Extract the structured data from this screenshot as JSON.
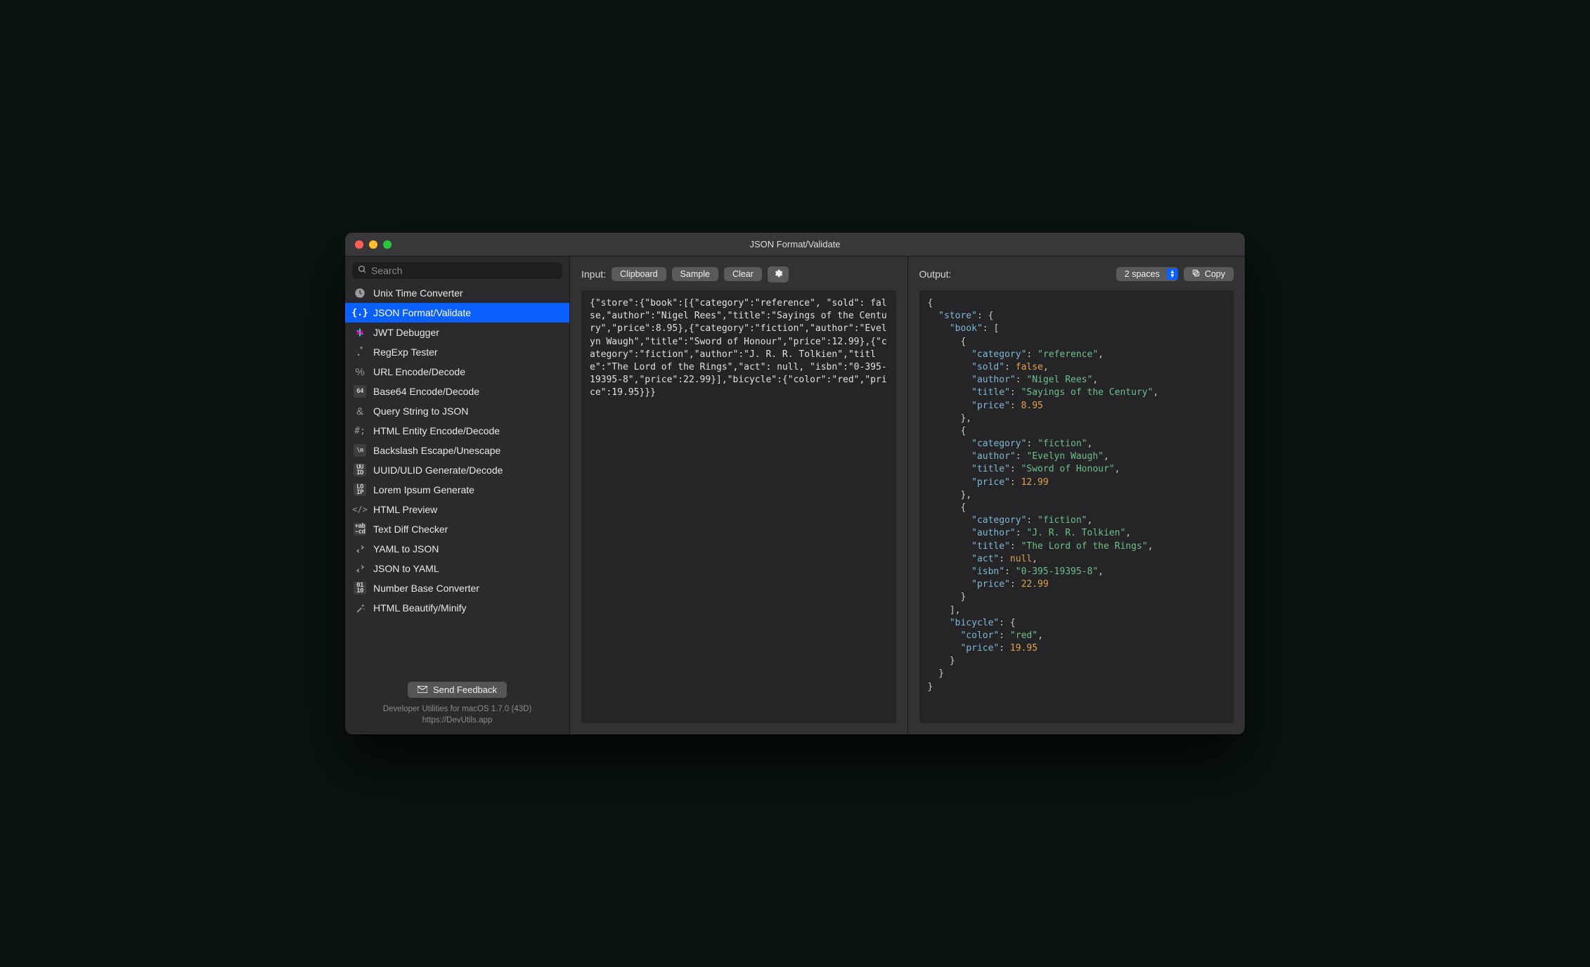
{
  "window": {
    "title": "JSON Format/Validate"
  },
  "search": {
    "placeholder": "Search"
  },
  "sidebar": {
    "items": [
      {
        "icon": "clock",
        "label": "Unix Time Converter"
      },
      {
        "icon": "braces",
        "label": "JSON Format/Validate",
        "selected": true
      },
      {
        "icon": "jwt",
        "label": "JWT Debugger"
      },
      {
        "icon": "regex",
        "label": "RegExp Tester"
      },
      {
        "icon": "percent",
        "label": "URL Encode/Decode"
      },
      {
        "icon": "b64",
        "label": "Base64 Encode/Decode",
        "badge": "64"
      },
      {
        "icon": "amp",
        "label": "Query String to JSON"
      },
      {
        "icon": "hash",
        "label": "HTML Entity Encode/Decode"
      },
      {
        "icon": "bslash",
        "label": "Backslash Escape/Unescape",
        "badge": "\\n"
      },
      {
        "icon": "uuid",
        "label": "UUID/ULID Generate/Decode",
        "badge": "UU\nID"
      },
      {
        "icon": "lorem",
        "label": "Lorem Ipsum Generate",
        "badge": "LO\nIP"
      },
      {
        "icon": "html",
        "label": "HTML Preview"
      },
      {
        "icon": "diff",
        "label": "Text Diff Checker",
        "badge": "+ab\n-cd"
      },
      {
        "icon": "swap",
        "label": "YAML to JSON"
      },
      {
        "icon": "swap",
        "label": "JSON to YAML"
      },
      {
        "icon": "numbase",
        "label": "Number Base Converter",
        "badge": "01\n10"
      },
      {
        "icon": "wand",
        "label": "HTML Beautify/Minify"
      }
    ]
  },
  "footer": {
    "feedback_label": "Send Feedback",
    "app_line1": "Developer Utilities for macOS 1.7.0 (43D)",
    "app_line2": "https://DevUtils.app"
  },
  "input_pane": {
    "title": "Input:",
    "buttons": {
      "clipboard": "Clipboard",
      "sample": "Sample",
      "clear": "Clear"
    },
    "raw": "{\"store\":{\"book\":[{\"category\":\"reference\", \"sold\": false,\"author\":\"Nigel Rees\",\"title\":\"Sayings of the Century\",\"price\":8.95},{\"category\":\"fiction\",\"author\":\"Evelyn Waugh\",\"title\":\"Sword of Honour\",\"price\":12.99},{\"category\":\"fiction\",\"author\":\"J. R. R. Tolkien\",\"title\":\"The Lord of the Rings\",\"act\": null, \"isbn\":\"0-395-19395-8\",\"price\":22.99}],\"bicycle\":{\"color\":\"red\",\"price\":19.95}}}"
  },
  "output_pane": {
    "title": "Output:",
    "indent_label": "2 spaces",
    "copy_label": "Copy",
    "json": {
      "store": {
        "book": [
          {
            "category": "reference",
            "sold": false,
            "author": "Nigel Rees",
            "title": "Sayings of the Century",
            "price": 8.95
          },
          {
            "category": "fiction",
            "author": "Evelyn Waugh",
            "title": "Sword of Honour",
            "price": 12.99
          },
          {
            "category": "fiction",
            "author": "J. R. R. Tolkien",
            "title": "The Lord of the Rings",
            "act": null,
            "isbn": "0-395-19395-8",
            "price": 22.99
          }
        ],
        "bicycle": {
          "color": "red",
          "price": 19.95
        }
      }
    }
  }
}
